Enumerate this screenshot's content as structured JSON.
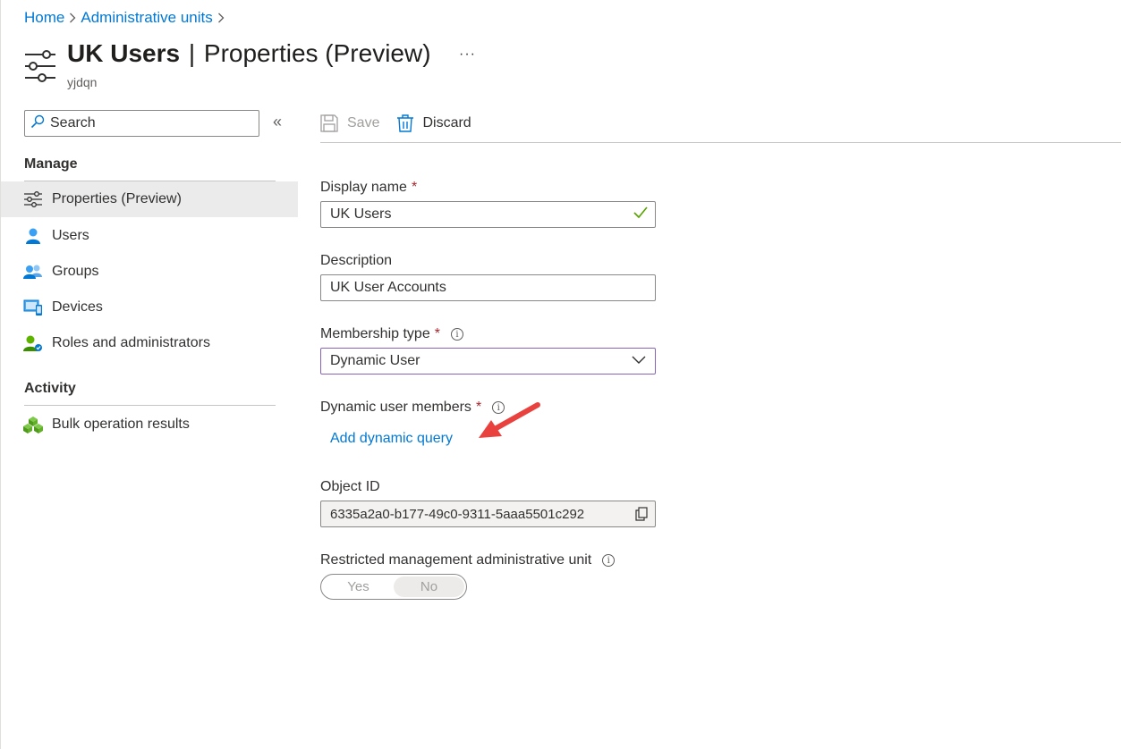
{
  "breadcrumb": {
    "home": "Home",
    "admin_units": "Administrative units"
  },
  "header": {
    "title_main": "UK Users",
    "title_sep": "|",
    "title_sub": "Properties (Preview)",
    "subtitle": "yjdqn",
    "more": "···",
    "icon": "properties-sliders-icon"
  },
  "nav": {
    "search_placeholder": "Search",
    "collapse": "«",
    "sections": [
      {
        "title": "Manage"
      },
      {
        "title": "Activity"
      }
    ],
    "items": [
      {
        "label": "Properties (Preview)",
        "icon": "sliders-icon",
        "active": true
      },
      {
        "label": "Users",
        "icon": "user-icon"
      },
      {
        "label": "Groups",
        "icon": "groups-icon"
      },
      {
        "label": "Devices",
        "icon": "devices-icon"
      },
      {
        "label": "Roles and administrators",
        "icon": "roles-icon"
      },
      {
        "label": "Bulk operation results",
        "icon": "bulk-ops-icon"
      }
    ]
  },
  "toolbar": {
    "save": "Save",
    "discard": "Discard"
  },
  "form": {
    "display_name_label": "Display name",
    "display_name_value": "UK Users",
    "description_label": "Description",
    "description_value": "UK User Accounts",
    "membership_label": "Membership type",
    "membership_value": "Dynamic User",
    "dynamic_members_label": "Dynamic user members",
    "add_query": "Add dynamic query",
    "object_id_label": "Object ID",
    "object_id_value": "6335a2a0-b177-49c0-9311-5aaa5501c292",
    "restricted_label": "Restricted management administrative unit",
    "toggle_yes": "Yes",
    "toggle_no": "No",
    "toggle_selected": "No",
    "required_mark": "*",
    "info_glyph": "i"
  },
  "colors": {
    "link": "#0078d4",
    "required": "#a4262c",
    "focus_border": "#8764b8",
    "valid_check": "#57a300",
    "annotation_arrow": "#e8413e"
  }
}
